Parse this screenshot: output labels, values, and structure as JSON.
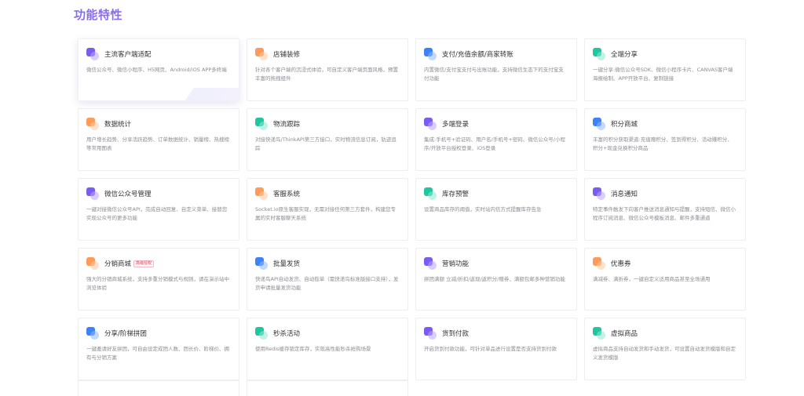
{
  "section_title": "功能特性",
  "features": [
    {
      "name": "主流客户端适配",
      "desc": "微信公众号、微信小程序、H5网页、Android/iOS APP多终端",
      "icon": "purple",
      "icon_name": "client-icon",
      "badge": ""
    },
    {
      "name": "店铺装修",
      "desc": "针对各个客户端的沉浸式体验，可自定义客户端页面风格，预置丰富的拖拽组件",
      "icon": "orange",
      "icon_name": "decoration-icon",
      "badge": ""
    },
    {
      "name": "支付/充值余额/商家转账",
      "desc": "内置微信/支付宝支付与出账功能，支持微信生态下的支付宝支付功能",
      "icon": "blue",
      "icon_name": "payment-icon",
      "badge": ""
    },
    {
      "name": "全端分享",
      "desc": "一键分享:微信公众号SDK、微信小程序卡片、CANVAS客户端海报绘制、APP开放平台、复制链接",
      "icon": "teal",
      "icon_name": "share-icon",
      "badge": ""
    },
    {
      "name": "数据统计",
      "desc": "用户增长趋势、分享活跃趋势、订单数据统计、销量榜、热搜榜等常用图表",
      "icon": "orange",
      "icon_name": "statistics-icon",
      "badge": ""
    },
    {
      "name": "物流跟踪",
      "desc": "对接快递鸟/ThinkAPI第三方接口，实时物流信息订阅，轨迹追踪",
      "icon": "teal",
      "icon_name": "logistics-icon",
      "badge": ""
    },
    {
      "name": "多端登录",
      "desc": "集成:手机号+验证码、用户名/手机号+密码、微信公众号/小程序/开放平台授权登录、iOS登录",
      "icon": "purple",
      "icon_name": "login-icon",
      "badge": ""
    },
    {
      "name": "积分商城",
      "desc": "丰富的积分获取渠道:充值赠积分、签到得积分、活动赚积分、积分+现金兑换积分商品",
      "icon": "blue",
      "icon_name": "points-mall-icon",
      "badge": ""
    },
    {
      "name": "微信公众号管理",
      "desc": "一键对接微信公众号API，完成自动回复、自定义菜单、接替您实现公众号的更多功能",
      "icon": "purple",
      "icon_name": "wechat-official-icon",
      "badge": ""
    },
    {
      "name": "客服系统",
      "desc": "Socket.io原生客服实现，无需对接任何第三方套件，构建您专属的实时客服聊天系统",
      "icon": "orange",
      "icon_name": "customer-service-icon",
      "badge": ""
    },
    {
      "name": "库存预警",
      "desc": "设置商品库存的阈值，实时站内信方式提醒库存告急",
      "icon": "teal",
      "icon_name": "inventory-icon",
      "badge": ""
    },
    {
      "name": "消息通知",
      "desc": "特定事件触发下向客户推送消息通知与提醒，支持短信、微信小程序订阅消息、微信公众号模板消息、邮件多重通道",
      "icon": "purple",
      "icon_name": "notification-icon",
      "badge": ""
    },
    {
      "name": "分销商城",
      "desc": "强大的分销商城系统，支持多重分销模式与规则，请在演示站中浏览体验",
      "icon": "orange",
      "icon_name": "distribution-icon",
      "badge": "高级授权"
    },
    {
      "name": "批量发货",
      "desc": "快递鸟API自动发货、自动揽单（需快递鸟标准版接口支持），发货申请批量发货功能",
      "icon": "blue",
      "icon_name": "batch-shipping-icon",
      "badge": ""
    },
    {
      "name": "营销功能",
      "desc": "拼团满额 立减/折扣/返现/返积分/赠券、满额包邮多种营销功能",
      "icon": "purple",
      "icon_name": "marketing-icon",
      "badge": ""
    },
    {
      "name": "优惠券",
      "desc": "满减券、满折券，一键自定义适用商品甚至全场通用",
      "icon": "orange",
      "icon_name": "coupon-icon",
      "badge": ""
    },
    {
      "name": "分享/阶梯拼团",
      "desc": "一键邀请好友拼团，可自由设定成团人数、团长价、阶梯价、拥有与分销方案",
      "icon": "blue",
      "icon_name": "group-buy-icon",
      "badge": ""
    },
    {
      "name": "秒杀活动",
      "desc": "使用Redis缓存锁定库存，实现高性能秒杀抢购场景",
      "icon": "teal",
      "icon_name": "flash-sale-icon",
      "badge": ""
    },
    {
      "name": "货到付款",
      "desc": "开启货到付款功能，可针对单品进行设置是否支持货到付款",
      "icon": "purple",
      "icon_name": "cash-on-delivery-icon",
      "badge": ""
    },
    {
      "name": "虚拟商品",
      "desc": "虚拟商品支持自动发货和手动发货，可设置自动发货模版和自定义发货模版",
      "icon": "teal",
      "icon_name": "virtual-goods-icon",
      "badge": ""
    }
  ]
}
